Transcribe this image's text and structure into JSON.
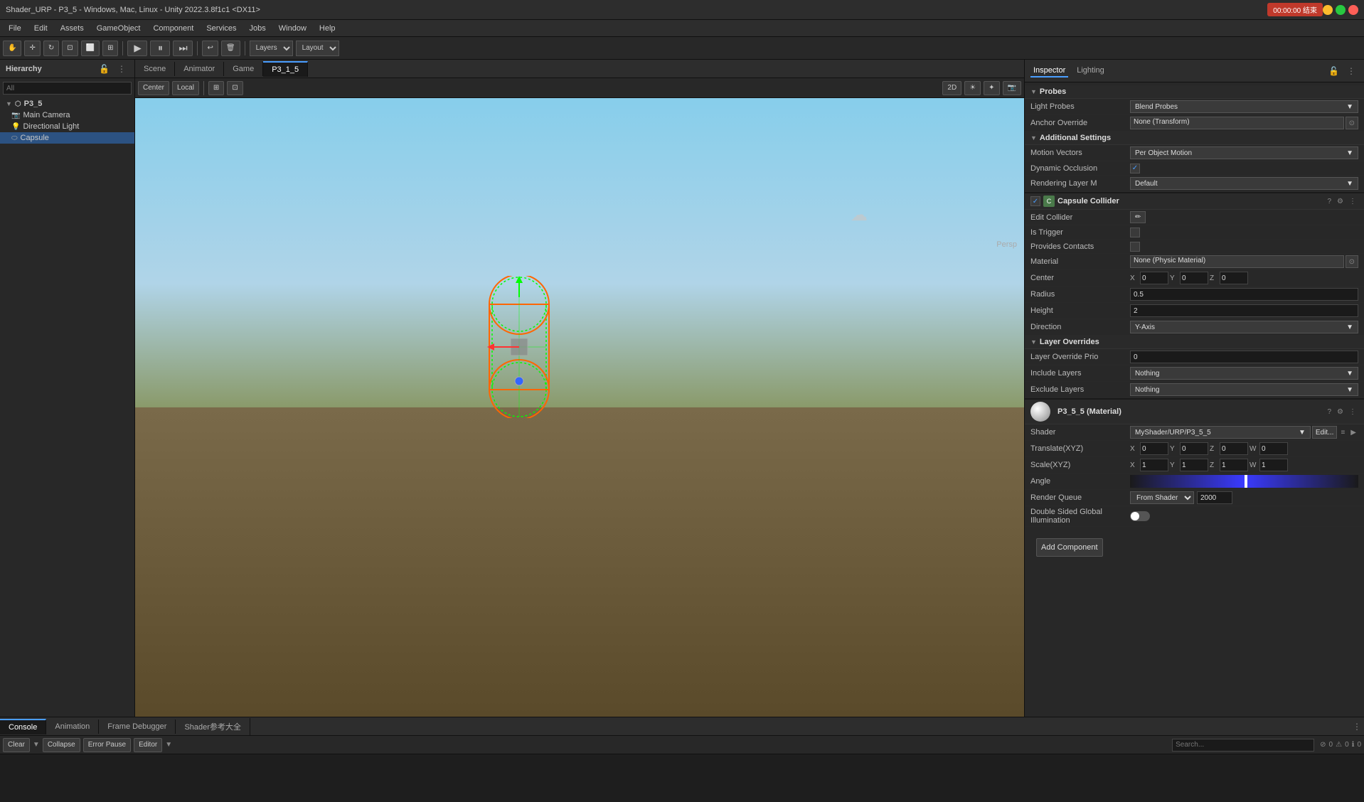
{
  "titleBar": {
    "title": "Shader_URP - P3_5 - Windows, Mac, Linux - Unity 2022.3.8f1c1 <DX11>",
    "recordBtn": "00:00:00 结束"
  },
  "menuBar": {
    "items": [
      "File",
      "Edit",
      "Assets",
      "GameObject",
      "Component",
      "Services",
      "Jobs",
      "Window",
      "Help"
    ]
  },
  "tabs": {
    "scene": "Scene",
    "animator": "Animator",
    "game": "Game",
    "active": "P3_1_5"
  },
  "hierarchy": {
    "title": "Hierarchy",
    "searchPlaceholder": "All",
    "items": [
      {
        "label": "P3_5",
        "level": 0,
        "expanded": true
      },
      {
        "label": "Main Camera",
        "level": 1
      },
      {
        "label": "Directional Light",
        "level": 1
      },
      {
        "label": "Capsule",
        "level": 1
      }
    ]
  },
  "inspector": {
    "title": "Inspector",
    "lightingTab": "Lighting",
    "probes": {
      "sectionTitle": "Probes",
      "lightProbesLabel": "Light Probes",
      "lightProbesValue": "Blend Probes",
      "anchorOverrideLabel": "Anchor Override",
      "anchorOverrideValue": "None (Transform)"
    },
    "additionalSettings": {
      "sectionTitle": "Additional Settings",
      "motionVectorsLabel": "Motion Vectors",
      "motionVectorsValue": "Per Object Motion",
      "dynamicOcclusionLabel": "Dynamic Occlusion",
      "dynamicOcclusionChecked": true,
      "renderingLayerLabel": "Rendering Layer M",
      "renderingLayerValue": "Default"
    },
    "capsuleCollider": {
      "title": "Capsule Collider",
      "editColliderLabel": "Edit Collider",
      "isTriggerLabel": "Is Trigger",
      "providesContactsLabel": "Provides Contacts",
      "materialLabel": "Material",
      "materialValue": "None (Physic Material)",
      "centerLabel": "Center",
      "centerX": "0",
      "centerY": "0",
      "centerZ": "0",
      "radiusLabel": "Radius",
      "radiusValue": "0.5",
      "heightLabel": "Height",
      "heightValue": "2",
      "directionLabel": "Direction",
      "directionValue": "Y-Axis"
    },
    "layerOverrides": {
      "sectionTitle": "Layer Overrides",
      "layerOverridePrioLabel": "Layer Override Prio",
      "layerOverridePrioValue": "0",
      "includeLayersLabel": "Include Layers",
      "includeLayersValue": "Nothing",
      "excludeLayersLabel": "Exclude Layers",
      "excludeLayersValue": "Nothing"
    },
    "material": {
      "title": "P3_5_5 (Material)",
      "shaderLabel": "Shader",
      "shaderValue": "MyShader/URP/P3_5_5",
      "editBtn": "Edit...",
      "translateLabel": "Translate(XYZ)",
      "translateX": "0",
      "translateY": "0",
      "translateZ": "0",
      "translateW": "0",
      "scaleLabel": "Scale(XYZ)",
      "scaleX": "1",
      "scaleY": "1",
      "scaleZ": "1",
      "scaleW": "1",
      "angleLabel": "Angle",
      "renderQueueLabel": "Render Queue",
      "renderQueueMode": "From Shader",
      "renderQueueValue": "2000",
      "doubleSidedGILabel": "Double Sided Global Illumination"
    },
    "addComponentBtn": "Add Component"
  },
  "bottomPanel": {
    "consoleTab": "Console",
    "animationTab": "Animation",
    "frameDebuggerTab": "Frame Debugger",
    "shaderRefTab": "Shader参考大全",
    "clearBtn": "Clear",
    "collapseBtn": "Collapse",
    "errorPauseBtn": "Error Pause",
    "editorBtn": "Editor",
    "errorCount": "0",
    "warningCount": "0",
    "infoCount": "0"
  },
  "playControls": {
    "playBtn": "▶",
    "pauseBtn": "⏸",
    "stepBtn": "⏭"
  },
  "sceneToolbar": {
    "centerMode": "Center",
    "localMode": "Local",
    "perspBtn": "Persp",
    "view2D": "2D"
  }
}
